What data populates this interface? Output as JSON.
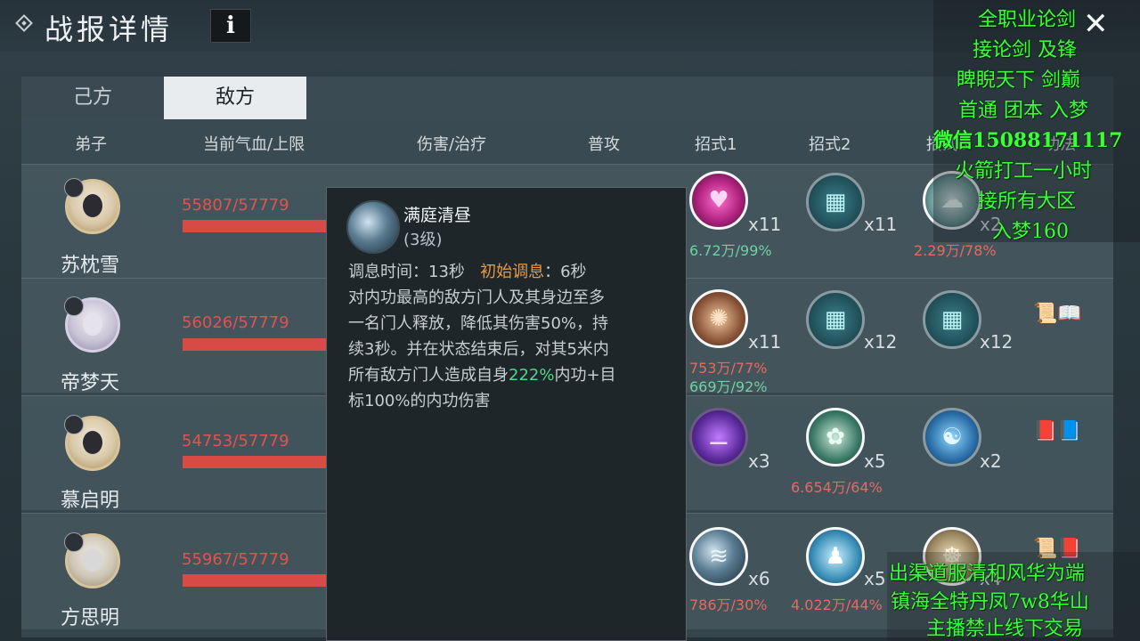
{
  "window": {
    "title": "战报详情",
    "info_label": "i",
    "close_label": "✕"
  },
  "tabs": [
    {
      "label": "己方"
    },
    {
      "label": "敌方"
    }
  ],
  "columns": [
    "弟子",
    "当前气血/上限",
    "伤害/治疗",
    "普攻",
    "招式1",
    "招式2",
    "招式3",
    "功法"
  ],
  "rows": [
    {
      "name": "苏枕雪",
      "hp": "55807/57779",
      "skill1_count": "x11",
      "skill1_stat": "6.72万/99%",
      "skill2_count": "x11",
      "skill3_count": "x2",
      "skill3_stat": "2.29万/78%"
    },
    {
      "name": "帝梦天",
      "hp": "56026/57779",
      "skill1_count": "x11",
      "skill1_stat": "753万/77%",
      "skill1_stat2": "669万/92%",
      "skill2_count": "x12",
      "skill3_count": "x12"
    },
    {
      "name": "慕启明",
      "hp": "54753/57779",
      "skill1_count": "x3",
      "skill2_count": "x5",
      "skill2_stat": "6.654万/64%",
      "skill3_count": "x2"
    },
    {
      "name": "方思明",
      "hp": "55967/57779",
      "skill1_count": "x6",
      "skill1_stat": "786万/30%",
      "skill2_count": "x5",
      "skill2_stat": "4.022万/44%",
      "skill3_count": "x4"
    }
  ],
  "tooltip": {
    "name": "满庭清昼",
    "level": "(3级)",
    "cooldown_label": "调息时间：13秒",
    "initial_label": "初始调息",
    "initial_value": "：6秒",
    "desc": [
      "对内功最高的敌方门人及其身边至多",
      "一名门人释放，降低其伤害50%，持",
      "续3秒。并在状态结束后，对其5米内"
    ],
    "desc4_pre": "所有敌方门人造成自身",
    "desc4_pct": "222%",
    "desc4_post": "内功+目",
    "desc5": "标100%的内功伤害"
  },
  "overlay_ad": {
    "top": [
      "全职业论剑",
      "接论剑 及锋",
      "睥睨天下  剑巅",
      "首通 团本 入梦",
      "微信15088171117",
      "火箭打工一小时",
      "接所有大区",
      "入梦160"
    ],
    "bottom": [
      "出渠道服清和风华为端",
      "镇海全特丹凤7w8华山",
      "主播禁止线下交易"
    ]
  },
  "icons": {
    "info": "info-icon",
    "close": "close-icon",
    "title": "diamond-icon"
  },
  "colors": {
    "hp_text": "#e0534f",
    "hp_bar": "#d84a46",
    "overlay_text": "#3aff3a",
    "highlight_orange": "#e59a48",
    "highlight_green": "#4fd88a"
  }
}
